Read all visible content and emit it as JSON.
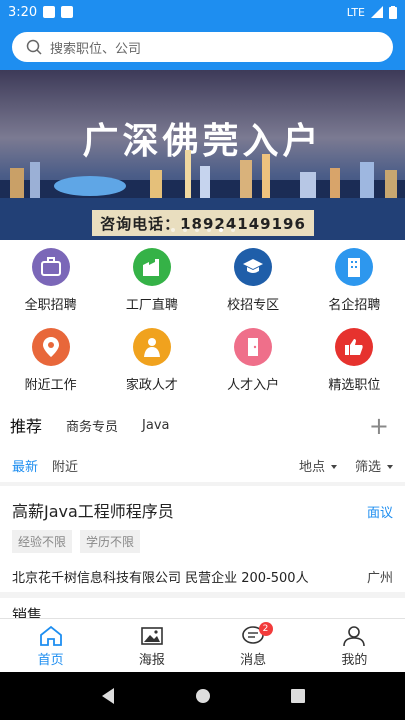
{
  "status": {
    "time": "3:20",
    "network": "LTE"
  },
  "search": {
    "placeholder": "搜索职位、公司"
  },
  "banner": {
    "title": "广深佛莞入户",
    "phone": "咨询电话：18924149196"
  },
  "categories": [
    {
      "label": "全职招聘",
      "icon": "briefcase-icon",
      "color": "#7b67b8"
    },
    {
      "label": "工厂直聘",
      "icon": "factory-icon",
      "color": "#35b247"
    },
    {
      "label": "校招专区",
      "icon": "graduation-cap-icon",
      "color": "#1f5ea9"
    },
    {
      "label": "名企招聘",
      "icon": "building-icon",
      "color": "#2d97ee"
    },
    {
      "label": "附近工作",
      "icon": "location-pin-icon",
      "color": "#e8673a"
    },
    {
      "label": "家政人才",
      "icon": "housekeeper-icon",
      "color": "#f0a21e"
    },
    {
      "label": "人才入户",
      "icon": "door-icon",
      "color": "#ef6f8a"
    },
    {
      "label": "精选职位",
      "icon": "thumbs-up-icon",
      "color": "#e6322e"
    }
  ],
  "tabs": [
    "推荐",
    "商务专员",
    "Java"
  ],
  "filters": {
    "latest": "最新",
    "nearby": "附近",
    "location": "地点",
    "screen": "筛选"
  },
  "jobs": [
    {
      "title": "高薪Java工程师程序员",
      "salary": "面议",
      "tags": [
        "经验不限",
        "学历不限"
      ],
      "company": "北京花千树信息科技有限公司 民营企业 200-500人",
      "city": "广州"
    },
    {
      "title": "销售"
    }
  ],
  "bottom_nav": [
    {
      "label": "首页",
      "icon": "home-icon"
    },
    {
      "label": "海报",
      "icon": "image-icon"
    },
    {
      "label": "消息",
      "icon": "chat-icon",
      "badge": "2"
    },
    {
      "label": "我的",
      "icon": "user-icon"
    }
  ]
}
